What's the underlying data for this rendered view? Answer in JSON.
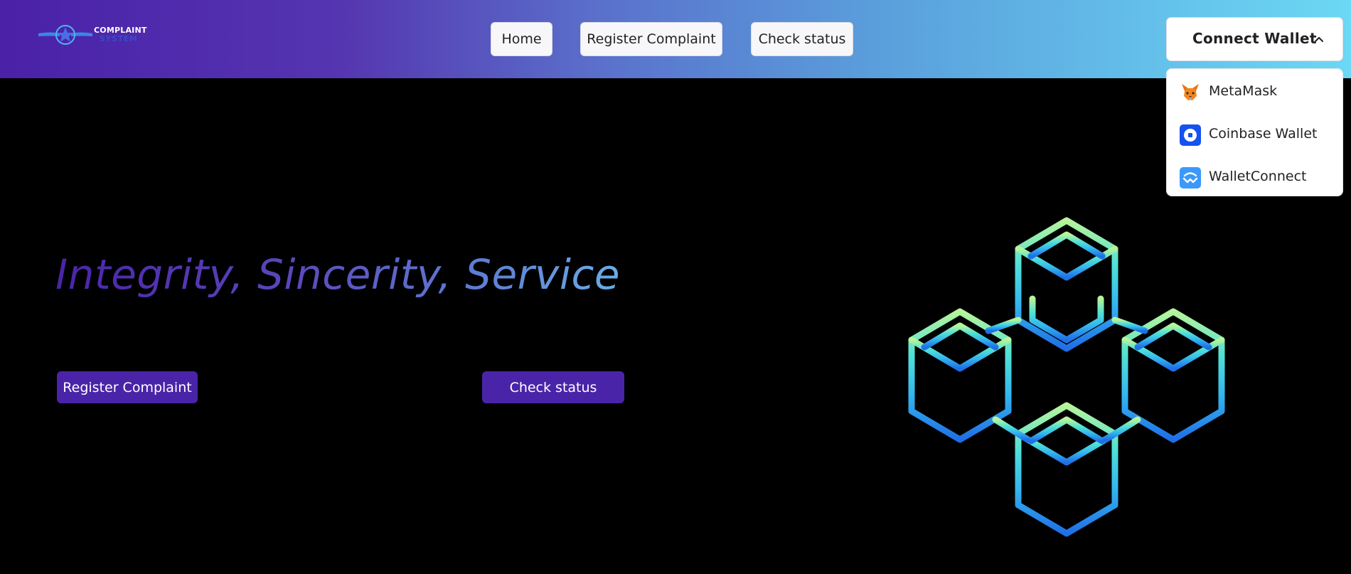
{
  "brand": {
    "logo_line1": "COMPLAINT",
    "logo_line2": "SYSTEM",
    "logo_icon": "star-wings-icon"
  },
  "nav": {
    "home": "Home",
    "register": "Register Complaint",
    "status": "Check status"
  },
  "wallet": {
    "button_label": "Connect Wallet",
    "menu_open": true,
    "options": [
      {
        "label": "MetaMask",
        "icon": "metamask-fox-icon"
      },
      {
        "label": "Coinbase Wallet",
        "icon": "coinbase-wallet-icon"
      },
      {
        "label": "WalletConnect",
        "icon": "walletconnect-icon"
      }
    ]
  },
  "hero": {
    "title": "Integrity, Sincerity, Service",
    "register_button": "Register Complaint",
    "status_button": "Check status",
    "illustration": "blockchain-cubes-icon"
  },
  "colors": {
    "accent": "#4a24a8",
    "nav_gradient_start": "#4a21a8",
    "nav_gradient_end": "#6bd8f4",
    "background": "#000000"
  }
}
